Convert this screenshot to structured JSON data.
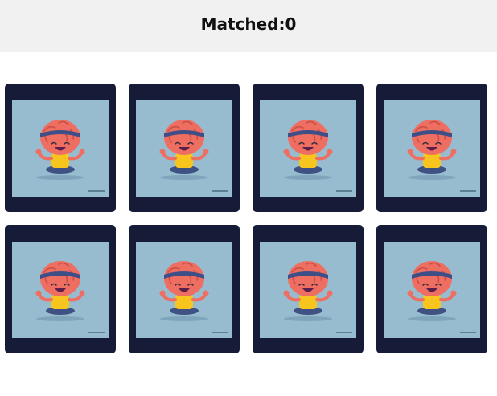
{
  "header": {
    "title": "Matched:0"
  },
  "board": {
    "cards": [
      {
        "label": "card-1",
        "icon": "meditating-brain-icon"
      },
      {
        "label": "card-2",
        "icon": "meditating-brain-icon"
      },
      {
        "label": "card-3",
        "icon": "meditating-brain-icon"
      },
      {
        "label": "card-4",
        "icon": "meditating-brain-icon"
      },
      {
        "label": "card-5",
        "icon": "meditating-brain-icon"
      },
      {
        "label": "card-6",
        "icon": "meditating-brain-icon"
      },
      {
        "label": "card-7",
        "icon": "meditating-brain-icon"
      },
      {
        "label": "card-8",
        "icon": "meditating-brain-icon"
      }
    ]
  },
  "colors": {
    "header_bg": "#f1f1f1",
    "card_back": "#161b37",
    "card_face": "#97bcd0",
    "brain": "#ef6e62",
    "shirt": "#f7c51e"
  }
}
